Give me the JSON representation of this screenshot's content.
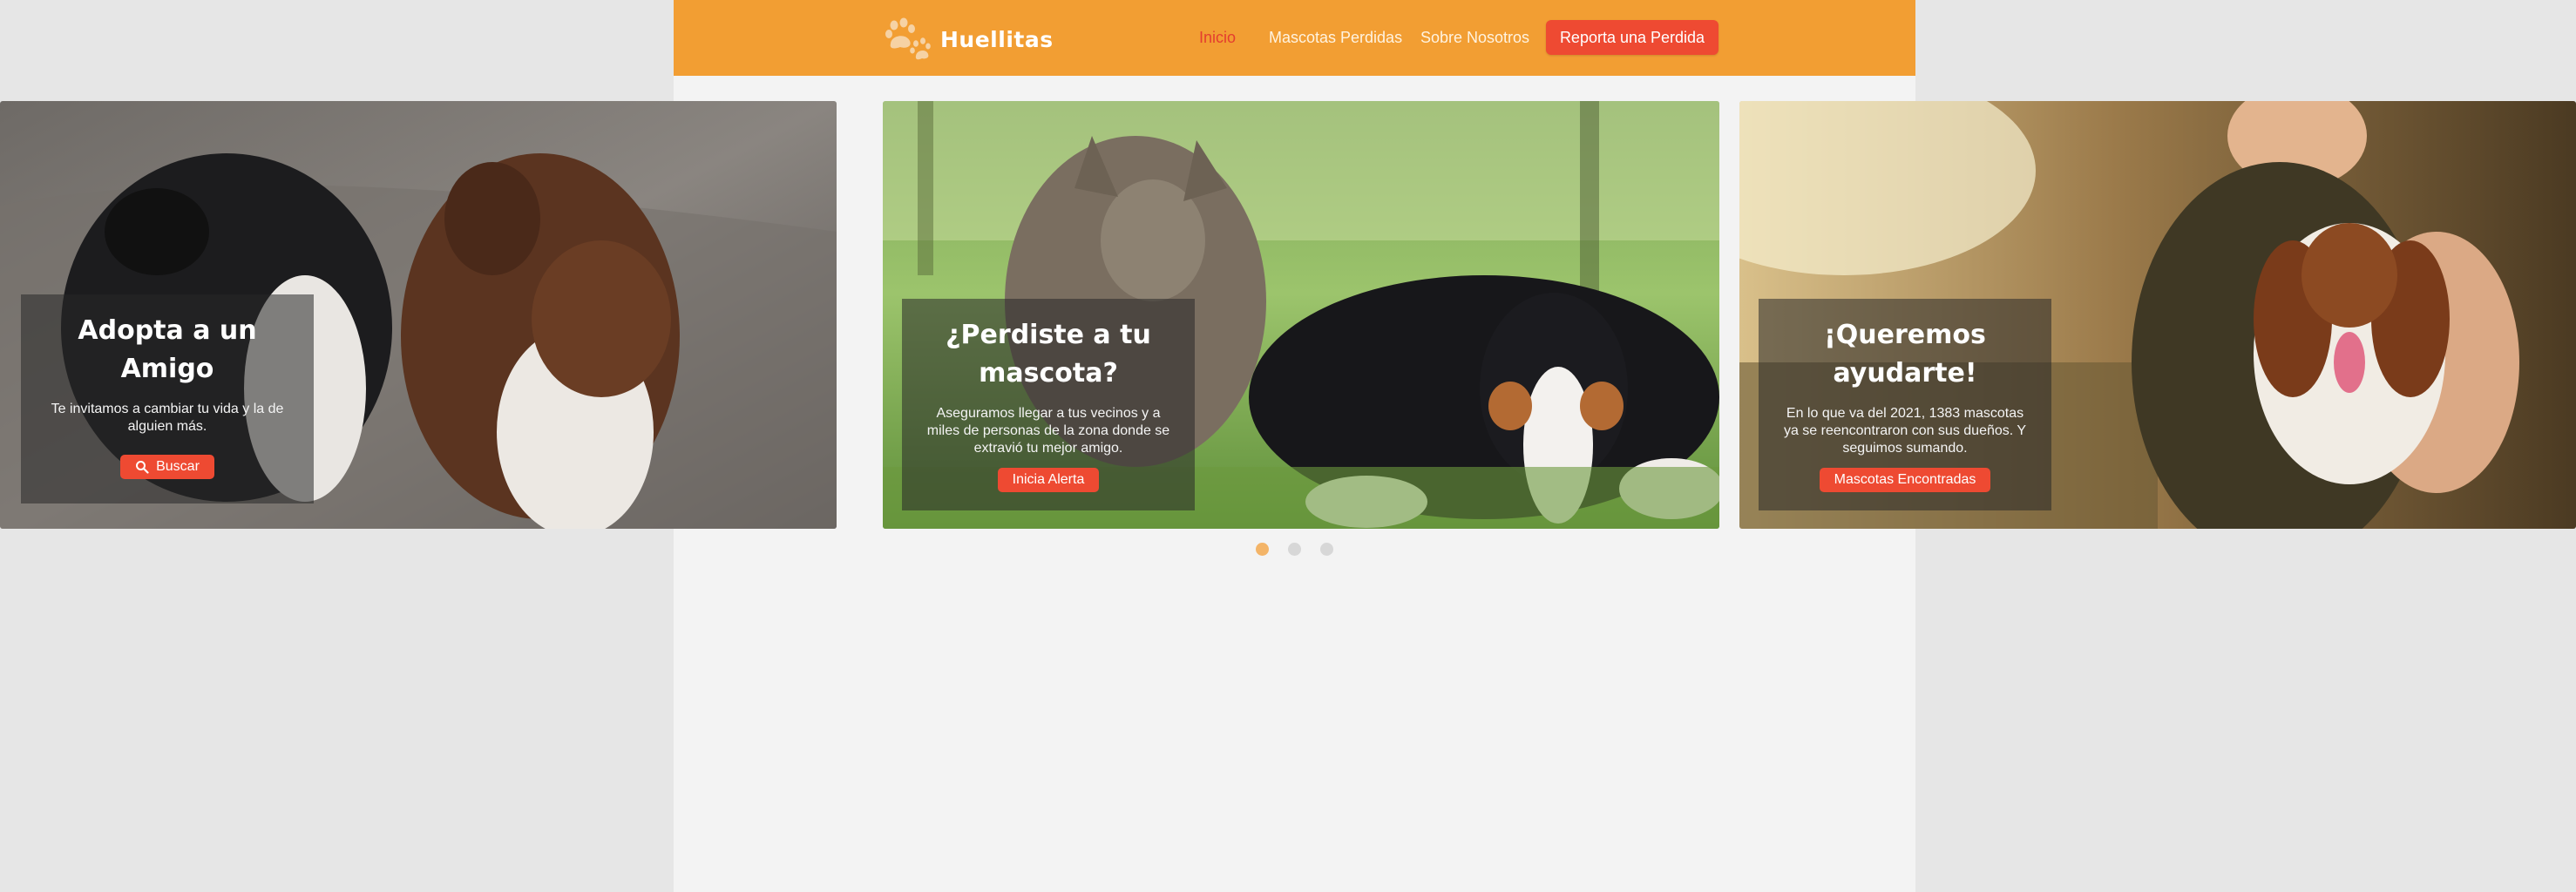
{
  "brand": {
    "name": "Huellitas",
    "accent": "#f29e33",
    "cta_color": "#ee4a32",
    "active_color": "#e43d2f"
  },
  "nav": {
    "items": [
      {
        "label": "Inicio",
        "active": true
      },
      {
        "label": "Mascotas Perdidas",
        "active": false
      },
      {
        "label": "Sobre Nosotros",
        "active": false
      }
    ],
    "cta_label": "Reporta una Perdida"
  },
  "carousel": {
    "slides": [
      {
        "title": "Adopta a un Amigo",
        "text": "Te invitamos a cambiar tu vida y la de alguien más.",
        "button_label": "Buscar",
        "button_icon": "search-icon",
        "image": "two-puppies"
      },
      {
        "title": "¿Perdiste a tu mascota?",
        "text": "Aseguramos llegar a tus vecinos y a miles de personas de la zona donde se extravió tu mejor amigo.",
        "button_label": "Inicia Alerta",
        "image": "cat-and-dog-on-grass"
      },
      {
        "title": "¡Queremos ayudarte!",
        "text": "En lo que va del 2021, 1383 mascotas ya se reencontraron con sus dueños. Y seguimos sumando.",
        "button_label": "Mascotas Encontradas",
        "image": "woman-holding-dog"
      }
    ],
    "active_index": 0,
    "indicator_count": 3
  }
}
